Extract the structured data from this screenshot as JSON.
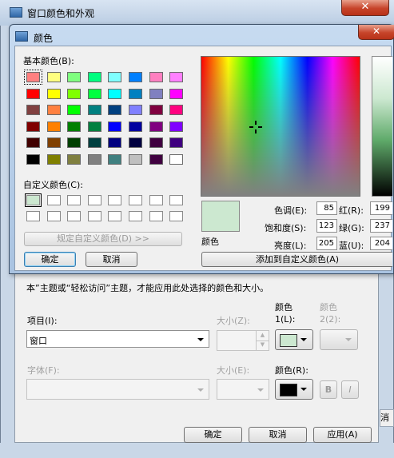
{
  "outer": {
    "title": "窗口颜色和外观",
    "note": "本”主题或“轻松访问”主题，才能应用此处选择的颜色和大小。",
    "item_label": "项目(I):",
    "item_value": "窗口",
    "size_label_1": "大小(Z):",
    "color1_label_a": "颜色",
    "color1_label_b": "1(L):",
    "color2_label_a": "颜色",
    "color2_label_b": "2(2):",
    "font_label": "字体(F):",
    "size_label_2": "大小(E):",
    "color_r_label": "颜色(R):",
    "bold_label": "B",
    "italic_label": "I",
    "ok": "确定",
    "cancel": "取消",
    "apply": "应用(A)",
    "edge_text": "消",
    "color1_hex": "#cce8d0",
    "color_r_hex": "#000000"
  },
  "dialog": {
    "title": "颜色",
    "basic_label": "基本颜色(B):",
    "basic_colors": [
      "#ff8080",
      "#ffff80",
      "#80ff80",
      "#00ff80",
      "#80ffff",
      "#0080ff",
      "#ff80c0",
      "#ff80ff",
      "#ff0000",
      "#ffff00",
      "#80ff00",
      "#00ff40",
      "#00ffff",
      "#0080c0",
      "#8080c0",
      "#ff00ff",
      "#804040",
      "#ff8040",
      "#00ff00",
      "#008080",
      "#004080",
      "#8080ff",
      "#800040",
      "#ff0080",
      "#800000",
      "#ff8000",
      "#008000",
      "#008040",
      "#0000ff",
      "#0000a0",
      "#800080",
      "#8000ff",
      "#400000",
      "#804000",
      "#004000",
      "#004040",
      "#000080",
      "#000040",
      "#400040",
      "#400080",
      "#000000",
      "#808000",
      "#808040",
      "#808080",
      "#408080",
      "#c0c0c0",
      "#400040",
      "#ffffff"
    ],
    "custom_label": "自定义颜色(C):",
    "custom_colors": [
      "#cce8d0",
      "#ffffff",
      "#ffffff",
      "#ffffff",
      "#ffffff",
      "#ffffff",
      "#ffffff",
      "#ffffff",
      "#ffffff",
      "#ffffff",
      "#ffffff",
      "#ffffff",
      "#ffffff",
      "#ffffff",
      "#ffffff",
      "#ffffff"
    ],
    "define_custom": "规定自定义颜色(D) >>",
    "ok": "确定",
    "cancel": "取消",
    "preview_label": "颜色",
    "preview_hex": "#cce8d0",
    "hue_label": "色调(E):",
    "hue": "85",
    "sat_label": "饱和度(S):",
    "sat": "123",
    "lum_label": "亮度(L):",
    "lum": "205",
    "red_label": "红(R):",
    "red": "199",
    "green_label": "绿(G):",
    "green": "237",
    "blue_label": "蓝(U):",
    "blue": "204",
    "add_custom": "添加到自定义颜色(A)"
  }
}
